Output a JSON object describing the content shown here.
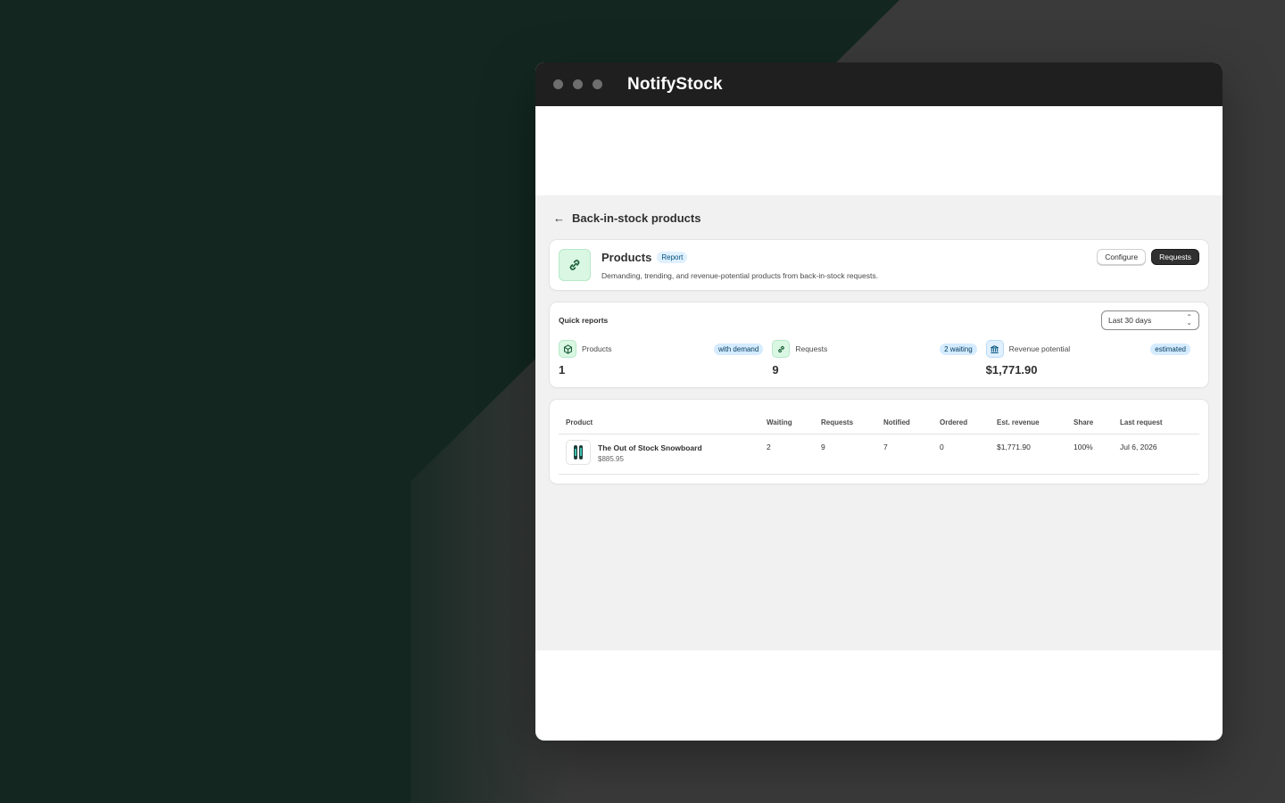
{
  "app": {
    "title": "NotifyStock"
  },
  "page": {
    "back_label": "Back-in-stock products"
  },
  "header_card": {
    "title": "Products",
    "badge": "Report",
    "description": "Demanding, trending, and revenue-potential products from back-in-stock requests.",
    "configure_label": "Configure",
    "requests_label": "Requests"
  },
  "quick_reports": {
    "title": "Quick reports",
    "range": "Last 30 days",
    "metrics": [
      {
        "label": "Products",
        "badge": "with demand",
        "value": "1",
        "icon": "package-icon"
      },
      {
        "label": "Requests",
        "badge": "2 waiting",
        "value": "9",
        "icon": "link-icon"
      },
      {
        "label": "Revenue potential",
        "badge": "estimated",
        "value": "$1,771.90",
        "icon": "bank-icon"
      }
    ]
  },
  "table": {
    "columns": [
      "Product",
      "Waiting",
      "Requests",
      "Notified",
      "Ordered",
      "Est. revenue",
      "Share",
      "Last request"
    ],
    "rows": [
      {
        "name": "The Out of Stock Snowboard",
        "price": "$885.95",
        "waiting": "2",
        "requests": "9",
        "notified": "7",
        "ordered": "0",
        "est_revenue": "$1,771.90",
        "share": "100%",
        "last_request": "Jul 6, 2026"
      }
    ]
  },
  "colors": {
    "accent_green_bg": "#d9f7e3",
    "badge_blue_bg": "#d5ebff",
    "primary_button": "#303030",
    "background_dark": "#132720"
  }
}
